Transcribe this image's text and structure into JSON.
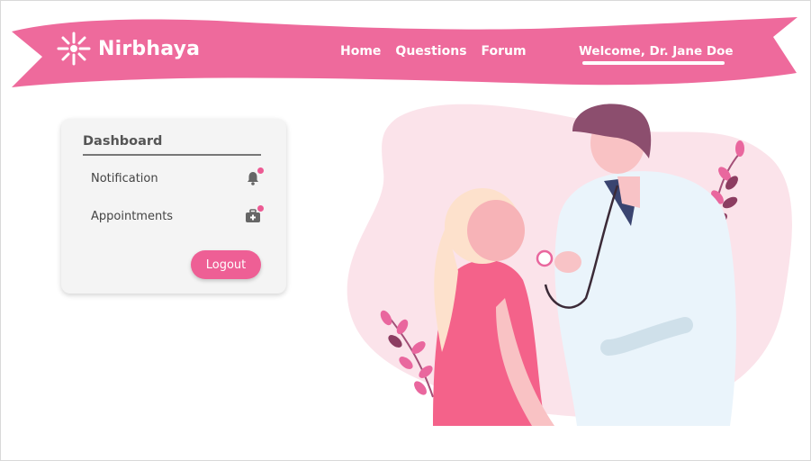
{
  "header": {
    "brand_name": "Nirbhaya",
    "brand_icon": "sparkle-people-icon",
    "nav": [
      {
        "label": "Home"
      },
      {
        "label": "Questions"
      },
      {
        "label": "Forum"
      }
    ],
    "welcome_text": "Welcome, Dr. Jane Doe"
  },
  "dashboard": {
    "title": "Dashboard",
    "items": [
      {
        "label": "Notification",
        "icon": "bell-icon",
        "has_badge": true
      },
      {
        "label": "Appointments",
        "icon": "medical-kit-icon",
        "has_badge": true
      }
    ],
    "logout_label": "Logout"
  },
  "illustration": {
    "subject": "doctor-patient-illustration"
  },
  "colors": {
    "brand_pink": "#ee6a9c",
    "button_pink": "#ee5f95",
    "card_bg": "#f4f4f4",
    "blob_pink": "#fbe3ea"
  }
}
